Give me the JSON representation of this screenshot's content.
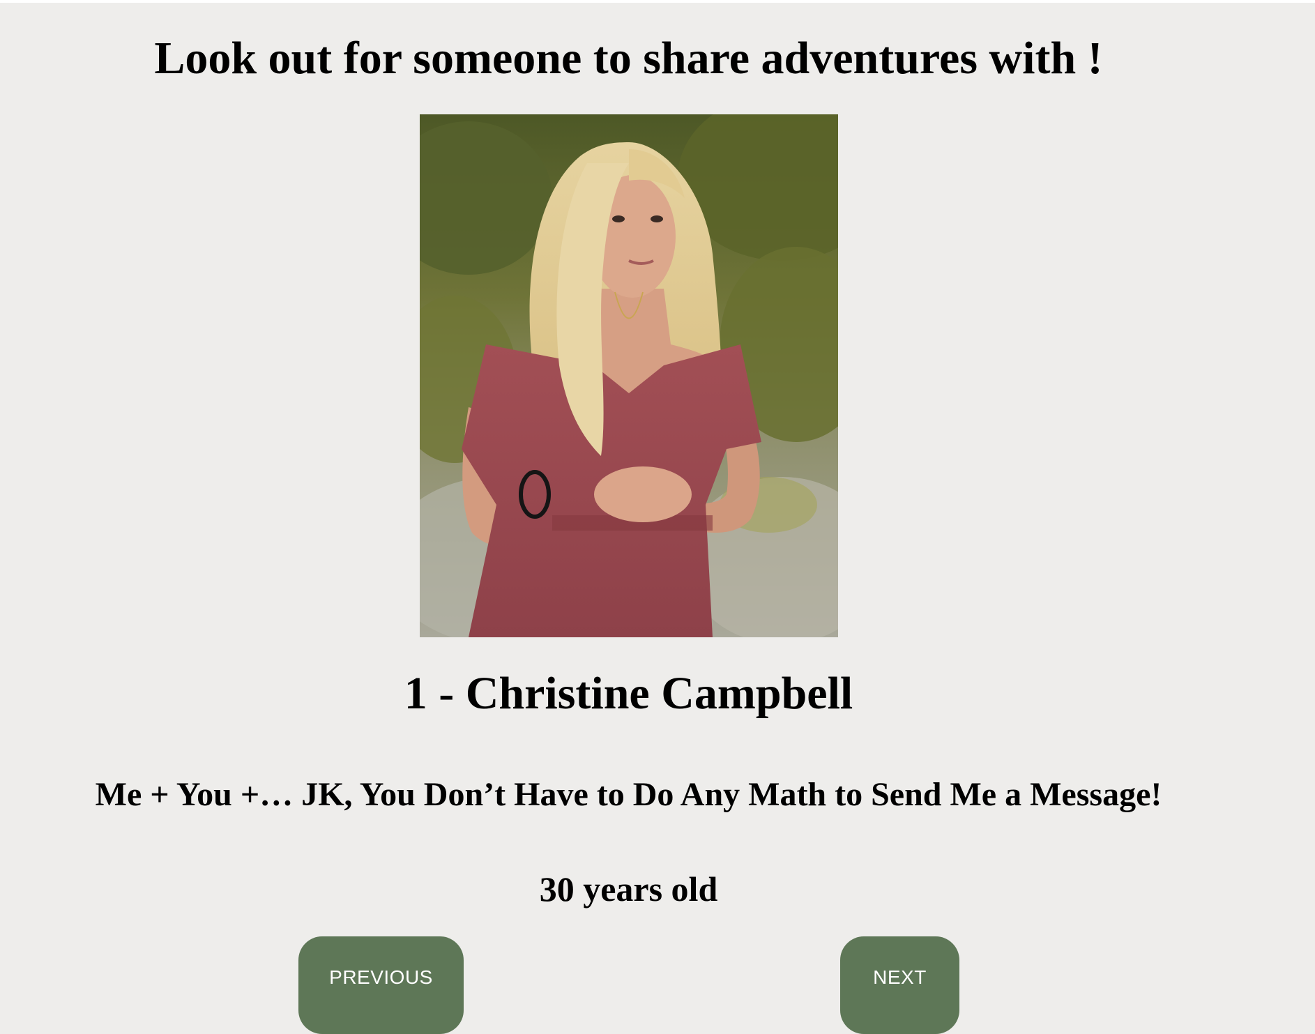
{
  "page": {
    "headline": "Look out for someone to share adventures with !",
    "background_color": "#eeedeb"
  },
  "profile": {
    "photo_alt": "Profile photo of Christine Campbell",
    "name_line": "1 - Christine Campbell",
    "tagline": "Me + You +… JK, You Don’t Have to Do Any Math to Send Me a Message!",
    "age_line": "30 years old"
  },
  "navigation": {
    "previous_label": "PREVIOUS",
    "next_label": "NEXT",
    "button_color": "#5e7757",
    "button_text_color": "#ffffff"
  }
}
